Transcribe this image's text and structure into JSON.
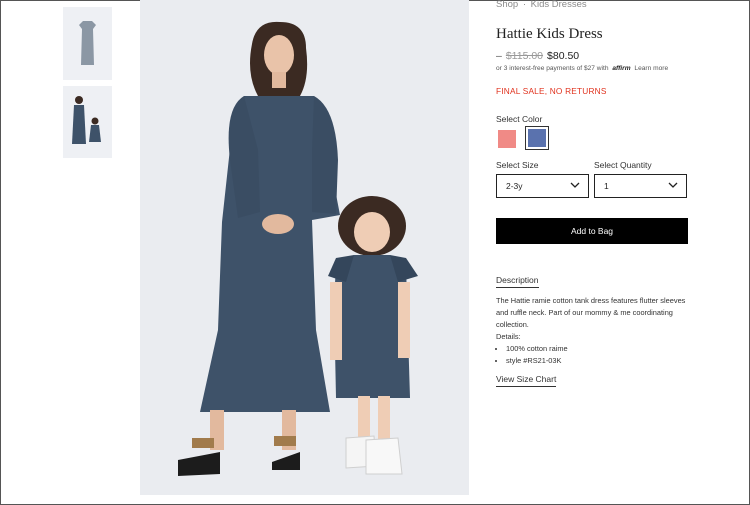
{
  "breadcrumb": {
    "shop": "Shop",
    "sep": "·",
    "category": "Kids Dresses"
  },
  "product": {
    "title": "Hattie Kids Dress",
    "price_dash": "–",
    "old_price": "$115.00",
    "new_price": "$80.50",
    "affirm_prefix": "or 3 interest-free payments of $27 with",
    "affirm_logo": "affirm",
    "affirm_link": "Learn more",
    "final_sale": "FINAL SALE, NO RETURNS"
  },
  "options": {
    "color_label": "Select Color",
    "colors": [
      {
        "name": "coral",
        "hex": "#f08a86"
      },
      {
        "name": "blue",
        "hex": "#5a72ae",
        "selected": true
      }
    ],
    "size_label": "Select Size",
    "size_value": "2-3y",
    "quantity_label": "Select Quantity",
    "quantity_value": "1"
  },
  "add_to_bag": "Add to Bag",
  "description": {
    "tab": "Description",
    "body": "The Hattie ramie cotton tank dress features flutter sleeves and ruffle neck. Part of our mommy & me coordinating collection.",
    "details_label": "Details:",
    "details": [
      "100% cotton raime",
      "style #RS21-03K"
    ]
  },
  "size_chart": "View Size Chart",
  "colors": {
    "dress": "#3e5269",
    "accent_red": "#e0321e",
    "button": "#000000"
  }
}
